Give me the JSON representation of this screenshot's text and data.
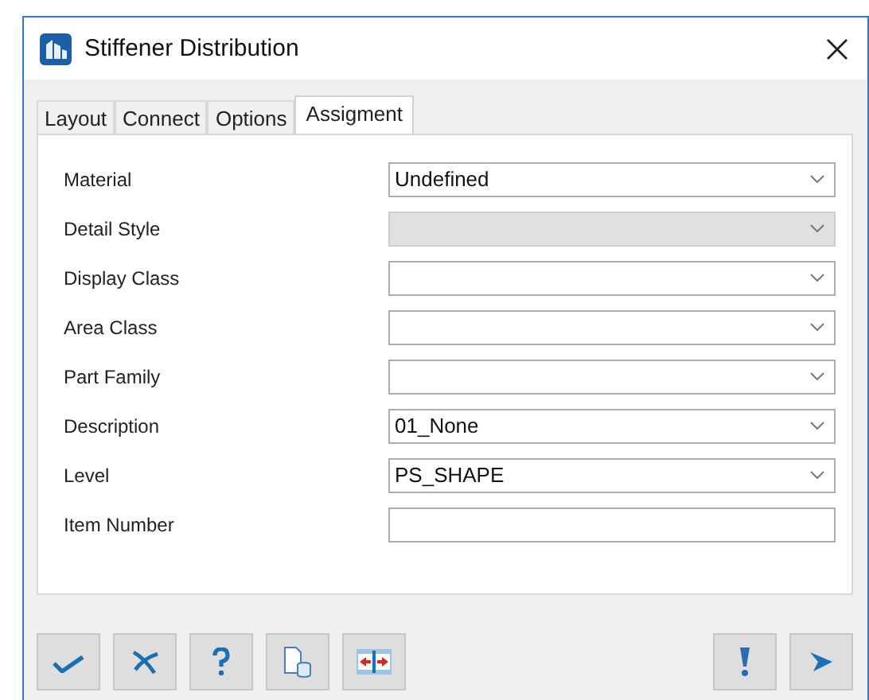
{
  "window": {
    "title": "Stiffener Distribution"
  },
  "tabs": [
    {
      "label": "Layout",
      "selected": false
    },
    {
      "label": "Connect",
      "selected": false
    },
    {
      "label": "Options",
      "selected": false
    },
    {
      "label": "Assigment",
      "selected": true
    }
  ],
  "fields": [
    {
      "label": "Material",
      "kind": "dropdown",
      "value": "Undefined",
      "disabled": false
    },
    {
      "label": "Detail Style",
      "kind": "dropdown",
      "disabled": true
    },
    {
      "label": "Display Class",
      "kind": "dropdown",
      "disabled": false
    },
    {
      "label": "Area Class",
      "kind": "dropdown",
      "disabled": false
    },
    {
      "label": "Part Family",
      "kind": "dropdown",
      "disabled": false
    },
    {
      "label": "Description",
      "kind": "dropdown",
      "value": "01_None",
      "disabled": false
    },
    {
      "label": "Level",
      "kind": "dropdown",
      "value": "PS_SHAPE",
      "disabled": false
    },
    {
      "label": "Item Number",
      "kind": "text",
      "disabled": false
    }
  ]
}
